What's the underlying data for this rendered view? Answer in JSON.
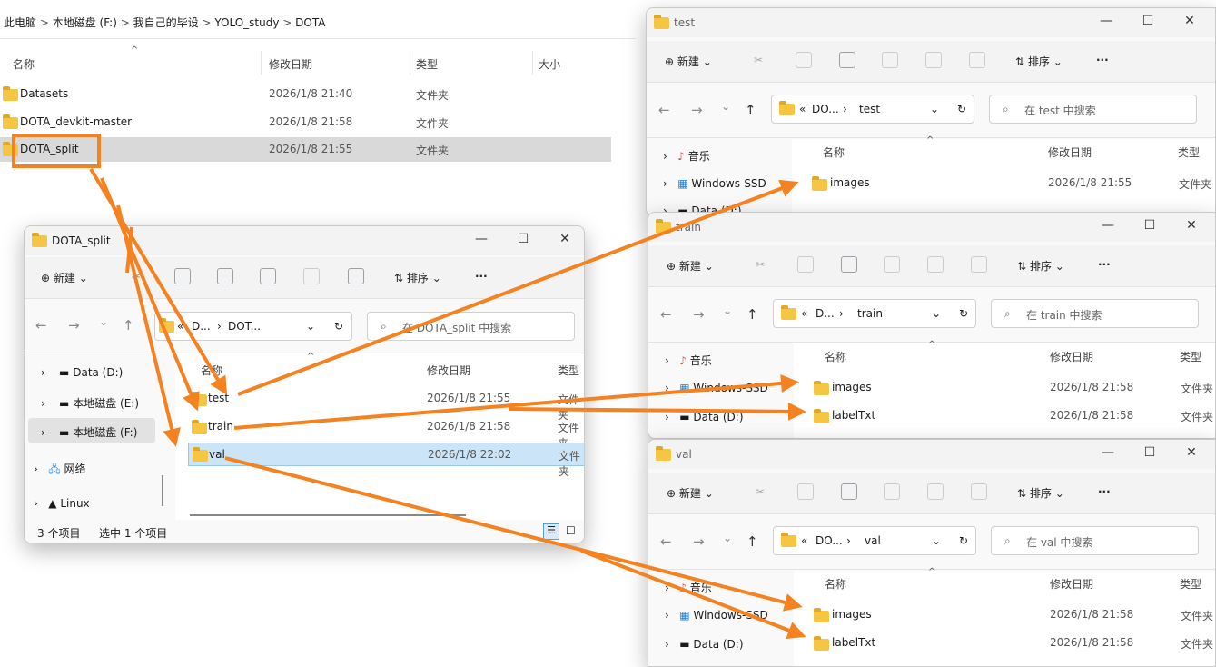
{
  "main": {
    "breadcrumb": [
      "此电脑",
      "本地磁盘 (F:)",
      "我自己的毕设",
      "YOLO_study",
      "DOTA"
    ],
    "columns": [
      "名称",
      "修改日期",
      "类型",
      "大小"
    ],
    "rows": [
      {
        "name": "Datasets",
        "date": "2026/1/8 21:40",
        "type": "文件夹"
      },
      {
        "name": "DOTA_devkit-master",
        "date": "2026/1/8 21:58",
        "type": "文件夹"
      },
      {
        "name": "DOTA_split",
        "date": "2026/1/8 21:55",
        "type": "文件夹"
      }
    ]
  },
  "split": {
    "title": "DOTA_split",
    "new_label": "新建",
    "sort_label": "排序",
    "address": [
      "«",
      "D...",
      "DOT..."
    ],
    "search_placeholder": "在 DOTA_split 中搜索",
    "nav": [
      "Data (D:)",
      "本地磁盘 (E:)",
      "本地磁盘 (F:)",
      "网络",
      "Linux"
    ],
    "columns": [
      "名称",
      "修改日期",
      "类型"
    ],
    "rows": [
      {
        "name": "test",
        "date": "2026/1/8 21:55",
        "type": "文件夹"
      },
      {
        "name": "train",
        "date": "2026/1/8 21:58",
        "type": "文件夹"
      },
      {
        "name": "val",
        "date": "2026/1/8 22:02",
        "type": "文件夹"
      }
    ],
    "status_count": "3 个项目",
    "status_sel": "选中 1 个项目"
  },
  "test": {
    "title": "test",
    "new_label": "新建",
    "sort_label": "排序",
    "address": [
      "«",
      "DO...",
      "test"
    ],
    "search_placeholder": "在 test 中搜索",
    "nav": [
      "音乐",
      "Windows-SSD",
      "Data (D:)"
    ],
    "columns": [
      "名称",
      "修改日期",
      "类型"
    ],
    "rows": [
      {
        "name": "images",
        "date": "2026/1/8 21:55",
        "type": "文件夹"
      }
    ]
  },
  "train": {
    "title": "train",
    "new_label": "新建",
    "sort_label": "排序",
    "address": [
      "«",
      "D...",
      "train"
    ],
    "search_placeholder": "在 train 中搜索",
    "nav": [
      "音乐",
      "Windows-SSD",
      "Data (D:)"
    ],
    "columns": [
      "名称",
      "修改日期",
      "类型"
    ],
    "rows": [
      {
        "name": "images",
        "date": "2026/1/8 21:58",
        "type": "文件夹"
      },
      {
        "name": "labelTxt",
        "date": "2026/1/8 21:58",
        "type": "文件夹"
      }
    ]
  },
  "val": {
    "title": "val",
    "new_label": "新建",
    "sort_label": "排序",
    "address": [
      "«",
      "DO...",
      "val"
    ],
    "search_placeholder": "在 val 中搜索",
    "nav": [
      "音乐",
      "Windows-SSD",
      "Data (D:)"
    ],
    "columns": [
      "名称",
      "修改日期",
      "类型"
    ],
    "rows": [
      {
        "name": "images",
        "date": "2026/1/8 21:58",
        "type": "文件夹"
      },
      {
        "name": "labelTxt",
        "date": "2026/1/8 21:58",
        "type": "文件夹"
      }
    ]
  },
  "colors": {
    "arrow": "#f58220",
    "selection": "#cce4f7",
    "folder": "#f5c544"
  }
}
